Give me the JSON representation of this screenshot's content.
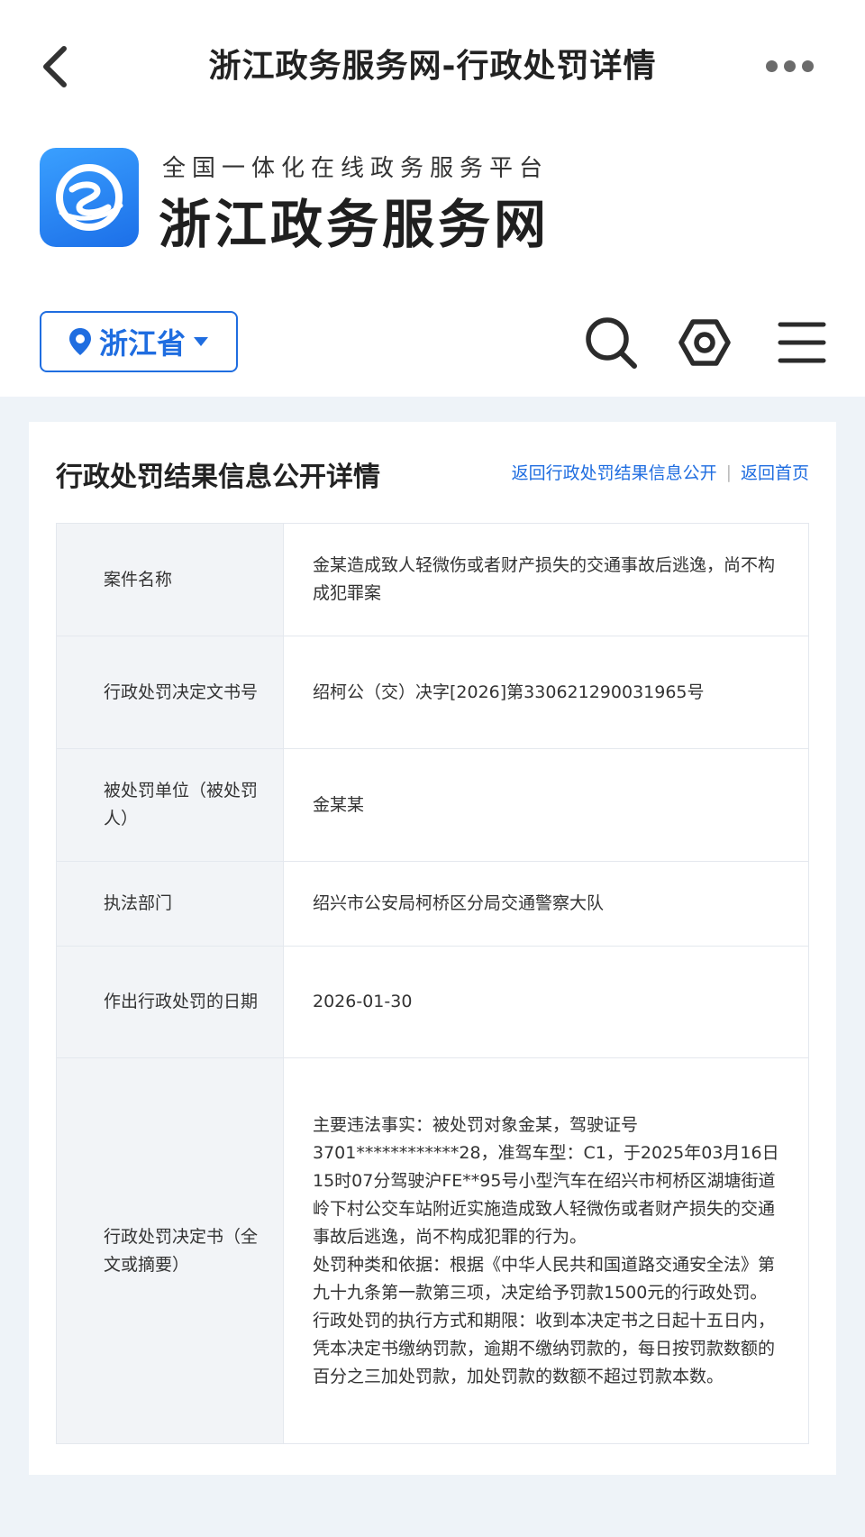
{
  "nav": {
    "title": "浙江政务服务网-行政处罚详情"
  },
  "brand": {
    "subtitle": "全国一体化在线政务服务平台",
    "name": "浙江政务服务网",
    "color": "#1f6de0"
  },
  "region": {
    "label": "浙江省"
  },
  "icons": [
    "back-icon",
    "more-icon",
    "location-pin-icon",
    "caret-down-icon",
    "search-icon",
    "settings-icon",
    "menu-icon"
  ],
  "card": {
    "title": "行政处罚结果信息公开详情",
    "link_return_list": "返回行政处罚结果信息公开",
    "separator": "|",
    "link_home": "返回首页"
  },
  "rows": [
    {
      "label": "案件名称",
      "value": "金某造成致人轻微伤或者财产损失的交通事故后逃逸，尚不构成犯罪案"
    },
    {
      "label": "行政处罚决定文书号",
      "value": "绍柯公（交）决字[2026]第330621290031965号"
    },
    {
      "label": "被处罚单位（被处罚人）",
      "value": "金某某"
    },
    {
      "label": "执法部门",
      "value": "绍兴市公安局柯桥区分局交通警察大队"
    },
    {
      "label": "作出行政处罚的日期",
      "value": "2026-01-30"
    },
    {
      "label": "行政处罚决定书（全文或摘要）",
      "paragraphs": [
        "主要违法事实：被处罚对象金某，驾驶证号3701************28，准驾车型：C1，于2025年03月16日15时07分驾驶沪FE**95号小型汽车在绍兴市柯桥区湖塘街道岭下村公交车站附近实施造成致人轻微伤或者财产损失的交通事故后逃逸，尚不构成犯罪的行为。",
        "处罚种类和依据：根据《中华人民共和国道路交通安全法》第九十九条第一款第三项，决定给予罚款1500元的行政处罚。",
        "行政处罚的执行方式和期限：收到本决定书之日起十五日内，凭本决定书缴纳罚款，逾期不缴纳罚款的，每日按罚款数额的百分之三加处罚款，加处罚款的数额不超过罚款本数。"
      ]
    }
  ]
}
